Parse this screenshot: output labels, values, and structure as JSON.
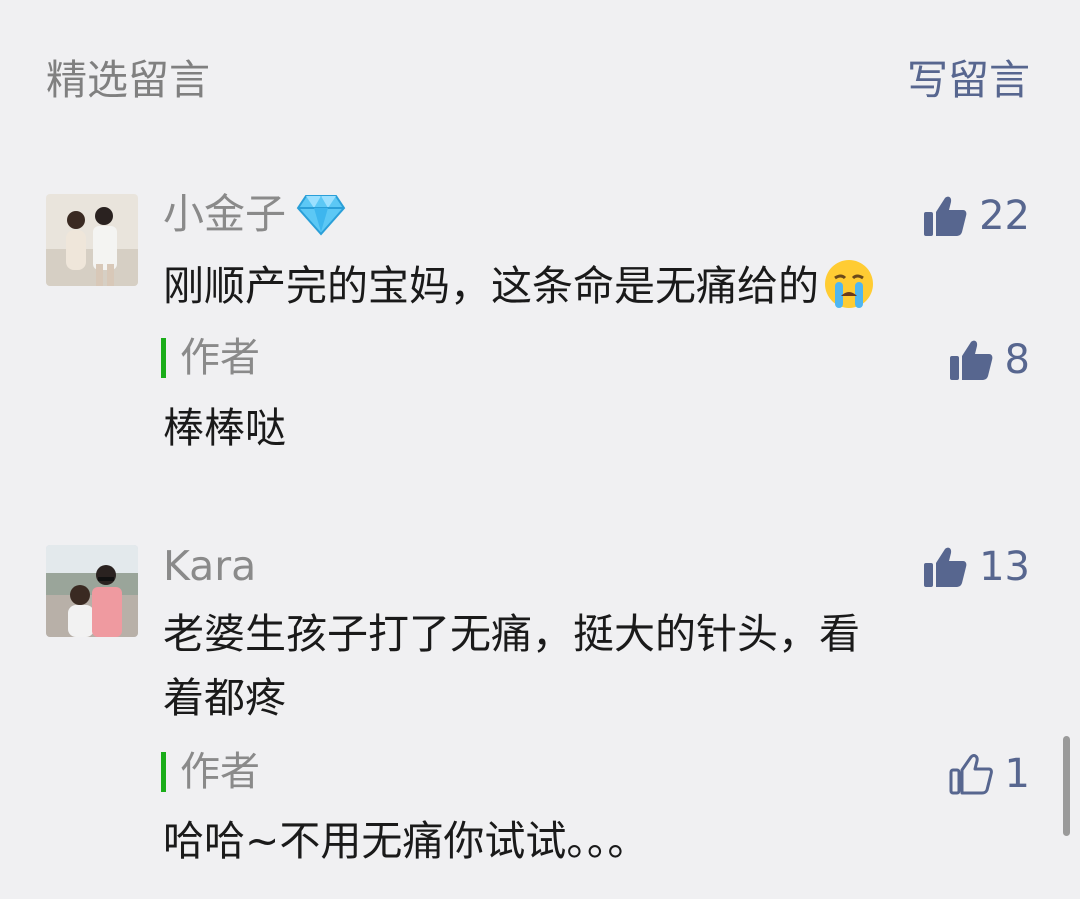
{
  "header": {
    "title": "精选留言",
    "write_label": "写留言"
  },
  "comments": [
    {
      "name": "小金子",
      "badge_icon": "diamond-icon",
      "likes": "22",
      "text": "刚顺产完的宝妈，这条命是无痛给的",
      "emoji_icon": "crying-face-icon",
      "reply": {
        "label": "作者",
        "likes": "8",
        "text": "棒棒哒"
      }
    },
    {
      "name": "Kara",
      "likes": "13",
      "text_line1": "老婆生孩子打了无痛，挺大的针头，看",
      "text_line2": "着都疼",
      "reply": {
        "label": "作者",
        "likes": "1",
        "text": "哈哈~不用无痛你试试。。。"
      }
    }
  ],
  "colors": {
    "link": "#57668f",
    "author_bar": "#1aad19",
    "background": "#f0f0f2"
  }
}
